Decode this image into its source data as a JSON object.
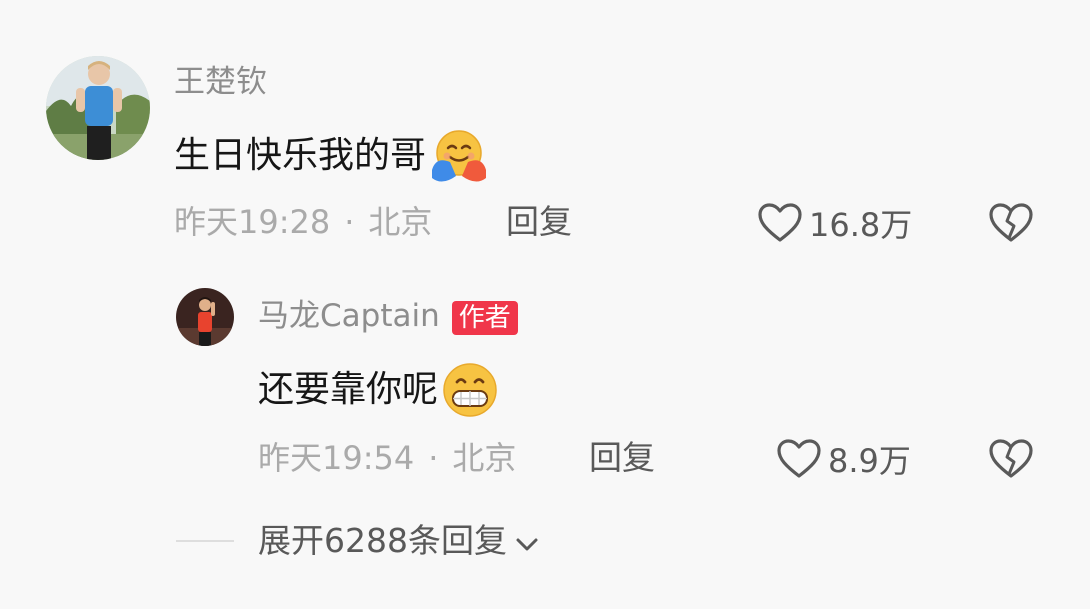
{
  "comment": {
    "username": "王楚钦",
    "text": "生日快乐我的哥",
    "emoji": "hugging-face-emoji",
    "time": "昨天19:28",
    "location": "北京",
    "reply_label": "回复",
    "likes": "16.8万"
  },
  "reply": {
    "username": "马龙Captain",
    "badge": "作者",
    "text": "还要靠你呢",
    "emoji": "grinning-face-emoji",
    "time": "昨天19:54",
    "location": "北京",
    "reply_label": "回复",
    "likes": "8.9万"
  },
  "expand": {
    "label": "展开6288条回复"
  },
  "colors": {
    "background": "#f8f8f8",
    "badge": "#f0364a",
    "text_primary": "#161616",
    "text_secondary": "#8d8d8d",
    "text_meta": "#aaaaaa"
  },
  "separator": "·"
}
